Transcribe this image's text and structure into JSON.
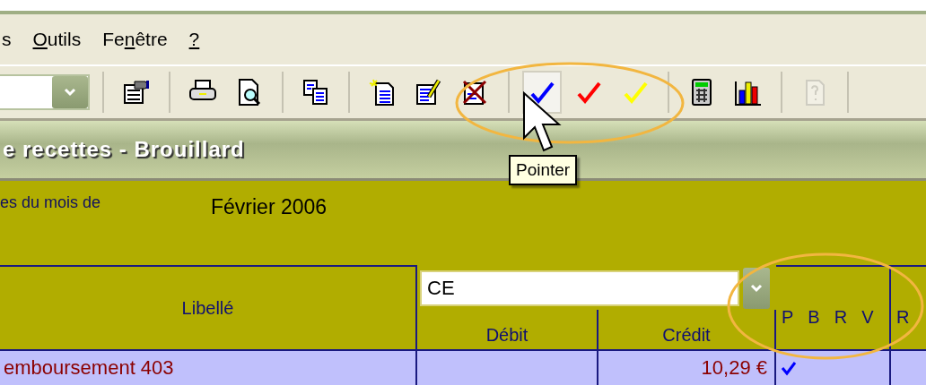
{
  "menu": [
    {
      "before": "s"
    },
    {
      "key": "O",
      "after": "utils"
    },
    {
      "before": "Fe",
      "key": "n",
      "after": "être"
    },
    {
      "key": "?"
    }
  ],
  "toolbar": {
    "groups": [
      [
        {
          "kind": "properties",
          "selected": false,
          "disabled": false
        }
      ],
      [
        {
          "kind": "print",
          "selected": false,
          "disabled": false
        },
        {
          "kind": "preview",
          "selected": false,
          "disabled": false
        }
      ],
      [
        {
          "kind": "copy",
          "selected": false,
          "disabled": false
        }
      ],
      [
        {
          "kind": "new",
          "selected": false,
          "disabled": false
        },
        {
          "kind": "edit",
          "selected": false,
          "disabled": false
        },
        {
          "kind": "delete",
          "selected": false,
          "disabled": false
        }
      ],
      [
        {
          "kind": "check",
          "color": "#0000ff",
          "selected": true,
          "disabled": false
        },
        {
          "kind": "check",
          "color": "#ff0000",
          "selected": false,
          "disabled": false
        },
        {
          "kind": "check",
          "color": "#ffff00",
          "selected": false,
          "disabled": false
        }
      ],
      [
        {
          "kind": "calculator",
          "selected": false,
          "disabled": false
        },
        {
          "kind": "chart",
          "selected": false,
          "disabled": false
        }
      ],
      [
        {
          "kind": "help",
          "selected": false,
          "disabled": true
        }
      ]
    ]
  },
  "tooltip": "Pointer",
  "title": "e recettes - Brouillard",
  "period": {
    "label": "es du mois de",
    "value": "Février 2006"
  },
  "table": {
    "columns": {
      "label": "Libellé",
      "account": "CE",
      "debit": "Débit",
      "credit": "Crédit",
      "flags": [
        "P",
        "B",
        "R",
        "V"
      ],
      "column_6": "R"
    },
    "rows": [
      {
        "label": "emboursement 403",
        "credit": "10,29 €",
        "flags": [
          true,
          false,
          false,
          false
        ]
      }
    ]
  }
}
